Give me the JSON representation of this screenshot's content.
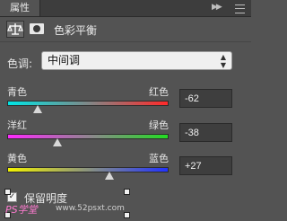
{
  "panel": {
    "tab_label": "属性",
    "title": "色彩平衡"
  },
  "tone": {
    "label": "色调:",
    "selected": "中间调"
  },
  "sliders": [
    {
      "left_label": "青色",
      "right_label": "红色",
      "value": "-62",
      "value_num": -62
    },
    {
      "left_label": "洋红",
      "right_label": "绿色",
      "value": "-38",
      "value_num": -38
    },
    {
      "left_label": "黄色",
      "right_label": "蓝色",
      "value": "+27",
      "value_num": 27
    }
  ],
  "preserve_luminosity": {
    "label": "保留明度",
    "checked": true
  },
  "watermark": {
    "logo": "PS学堂",
    "text": "www.52psxt.com"
  },
  "colors": {
    "background": "#535353",
    "cyan_red": [
      "#00e5e5",
      "#ff2a2a"
    ],
    "magenta_green": [
      "#ff2aff",
      "#22dd22"
    ],
    "yellow_blue": [
      "#f2f200",
      "#2233ff"
    ]
  },
  "icons": {
    "balance": "balance-scale-icon",
    "mask": "mask-icon",
    "collapse": "double-arrow-icon",
    "menu": "panel-menu-icon"
  }
}
